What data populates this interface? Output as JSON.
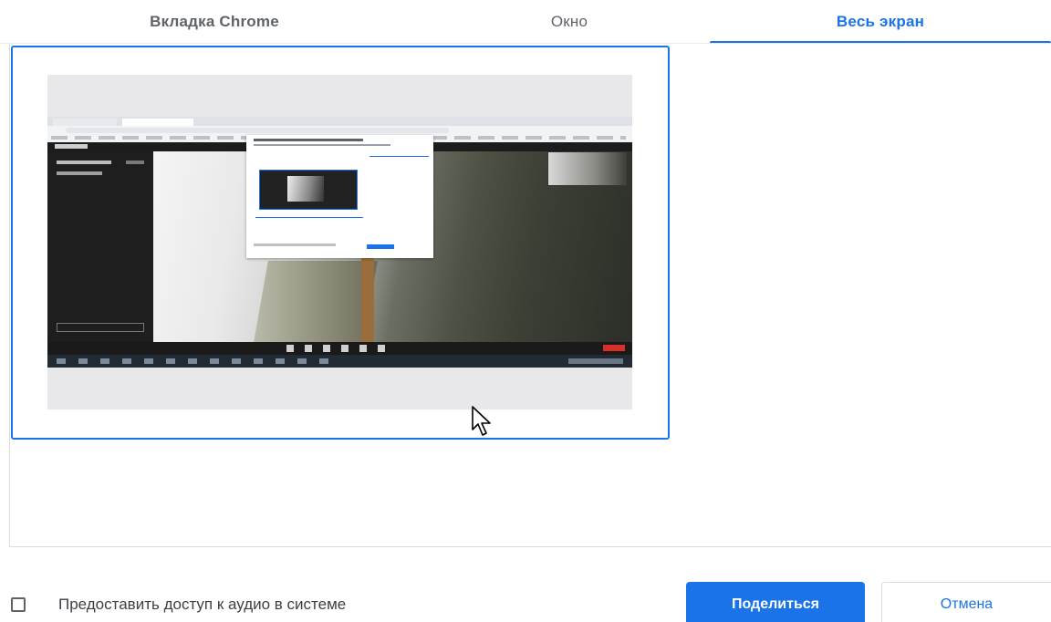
{
  "tabs": {
    "chrome_tab": "Вкладка Chrome",
    "window": "Окно",
    "entire_screen": "Весь экран",
    "active": "entire_screen"
  },
  "footer": {
    "share_audio_label": "Предоставить доступ к аудио в системе",
    "share_audio_checked": false,
    "share_button": "Поделиться",
    "cancel_button": "Отмена"
  },
  "colors": {
    "accent": "#1a73e8",
    "text_muted": "#5f6368",
    "border": "#dadce0"
  },
  "icons": {
    "cursor": "mouse-pointer-icon",
    "checkbox": "checkbox-unchecked-icon"
  }
}
